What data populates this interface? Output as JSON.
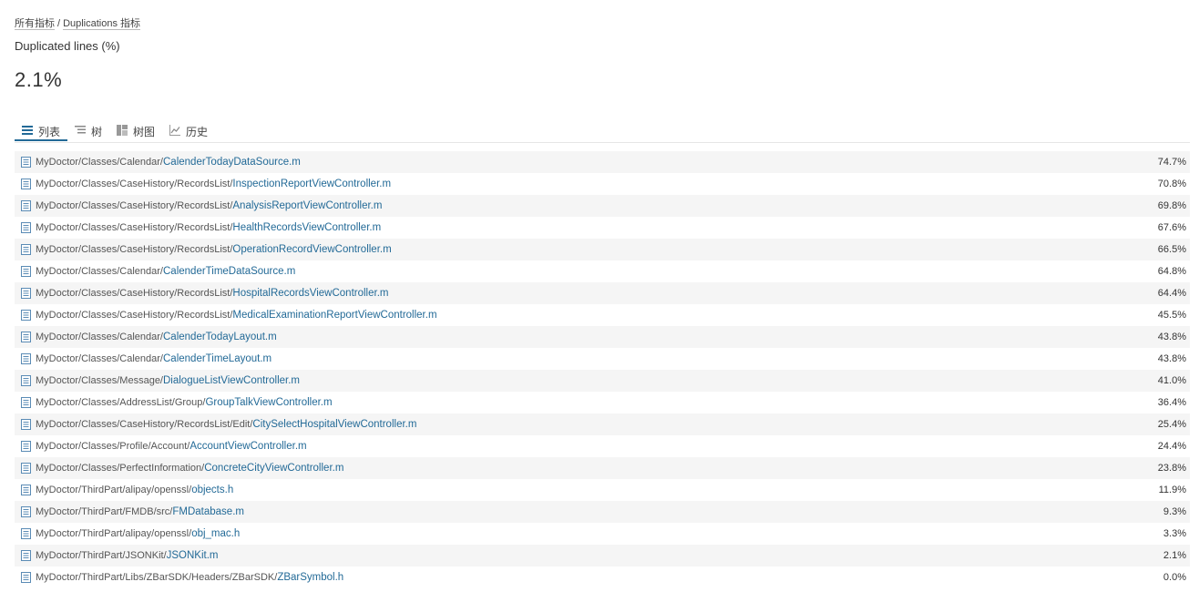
{
  "breadcrumb": {
    "all_metrics": "所有指标",
    "separator": "/",
    "current": "Duplications 指标"
  },
  "metric": {
    "title": "Duplicated lines (%)",
    "value": "2.1%"
  },
  "tabs": [
    {
      "label": "列表",
      "icon": "list-icon",
      "active": true
    },
    {
      "label": "树",
      "icon": "tree-icon",
      "active": false
    },
    {
      "label": "树图",
      "icon": "treemap-icon",
      "active": false
    },
    {
      "label": "历史",
      "icon": "history-chart-icon",
      "active": false
    }
  ],
  "files": [
    {
      "dir": "MyDoctor/Classes/Calendar/",
      "name": "CalenderTodayDataSource.m",
      "value": "74.7%"
    },
    {
      "dir": "MyDoctor/Classes/CaseHistory/RecordsList/",
      "name": "InspectionReportViewController.m",
      "value": "70.8%"
    },
    {
      "dir": "MyDoctor/Classes/CaseHistory/RecordsList/",
      "name": "AnalysisReportViewController.m",
      "value": "69.8%"
    },
    {
      "dir": "MyDoctor/Classes/CaseHistory/RecordsList/",
      "name": "HealthRecordsViewController.m",
      "value": "67.6%"
    },
    {
      "dir": "MyDoctor/Classes/CaseHistory/RecordsList/",
      "name": "OperationRecordViewController.m",
      "value": "66.5%"
    },
    {
      "dir": "MyDoctor/Classes/Calendar/",
      "name": "CalenderTimeDataSource.m",
      "value": "64.8%"
    },
    {
      "dir": "MyDoctor/Classes/CaseHistory/RecordsList/",
      "name": "HospitalRecordsViewController.m",
      "value": "64.4%"
    },
    {
      "dir": "MyDoctor/Classes/CaseHistory/RecordsList/",
      "name": "MedicalExaminationReportViewController.m",
      "value": "45.5%"
    },
    {
      "dir": "MyDoctor/Classes/Calendar/",
      "name": "CalenderTodayLayout.m",
      "value": "43.8%"
    },
    {
      "dir": "MyDoctor/Classes/Calendar/",
      "name": "CalenderTimeLayout.m",
      "value": "43.8%"
    },
    {
      "dir": "MyDoctor/Classes/Message/",
      "name": "DialogueListViewController.m",
      "value": "41.0%"
    },
    {
      "dir": "MyDoctor/Classes/AddressList/Group/",
      "name": "GroupTalkViewController.m",
      "value": "36.4%"
    },
    {
      "dir": "MyDoctor/Classes/CaseHistory/RecordsList/Edit/",
      "name": "CitySelectHospitalViewController.m",
      "value": "25.4%"
    },
    {
      "dir": "MyDoctor/Classes/Profile/Account/",
      "name": "AccountViewController.m",
      "value": "24.4%"
    },
    {
      "dir": "MyDoctor/Classes/PerfectInformation/",
      "name": "ConcreteCityViewController.m",
      "value": "23.8%"
    },
    {
      "dir": "MyDoctor/ThirdPart/alipay/openssl/",
      "name": "objects.h",
      "value": "11.9%"
    },
    {
      "dir": "MyDoctor/ThirdPart/FMDB/src/",
      "name": "FMDatabase.m",
      "value": "9.3%"
    },
    {
      "dir": "MyDoctor/ThirdPart/alipay/openssl/",
      "name": "obj_mac.h",
      "value": "3.3%"
    },
    {
      "dir": "MyDoctor/ThirdPart/JSONKit/",
      "name": "JSONKit.m",
      "value": "2.1%"
    },
    {
      "dir": "MyDoctor/ThirdPart/Libs/ZBarSDK/Headers/ZBarSDK/",
      "name": "ZBarSymbol.h",
      "value": "0.0%"
    }
  ],
  "colors": {
    "link": "#236a97",
    "active_tab_underline": "#236a97",
    "stripe": "#f5f5f5"
  }
}
